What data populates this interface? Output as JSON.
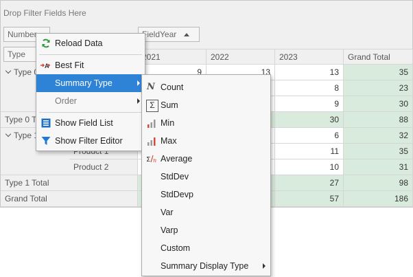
{
  "pivot": {
    "filter_area": "Drop Filter Fields Here",
    "data_field": "Number",
    "column_field": "FieldYear",
    "row_field": "Type",
    "column_headers": [
      "2021",
      "2022",
      "2023",
      "Grand Total"
    ],
    "rows": {
      "type0_header": "Type 0",
      "type0_total": "Type 0 Total",
      "type1_header": "Type 1",
      "type1_prod1": "Product 1",
      "type1_prod2": "Product 2",
      "type1_total": "Type 1 Total",
      "grand_total": "Grand Total"
    },
    "values": {
      "r1": [
        "9",
        "13",
        "13",
        "35"
      ],
      "r2": [
        "8",
        "23"
      ],
      "r3": [
        "9",
        "30"
      ],
      "r4": [
        "30",
        "88"
      ],
      "r5": [
        "6",
        "32"
      ],
      "r6": [
        "11",
        "35"
      ],
      "r7": [
        "10",
        "31"
      ],
      "r8": [
        "27",
        "98"
      ],
      "r9": [
        "57",
        "186"
      ]
    }
  },
  "context_menu": {
    "reload": "Reload Data",
    "best_fit": "Best Fit",
    "summary_type": "Summary Type",
    "order": "Order",
    "field_list": "Show Field List",
    "filter_editor": "Show Filter Editor"
  },
  "submenu": {
    "count": "Count",
    "sum": "Sum",
    "min": "Min",
    "max": "Max",
    "average": "Average",
    "stddev": "StdDev",
    "stddevp": "StdDevp",
    "var": "Var",
    "varp": "Varp",
    "custom": "Custom",
    "display_type": "Summary Display Type"
  },
  "colors": {
    "highlight": "#2e83d6",
    "grand_total_fill": "#d9ebdc",
    "reload_icon": "#2e9a3c",
    "field_list_icon": "#1f6fc7",
    "filter_icon": "#1f7ad6",
    "bar_icon": "#d04a3e"
  }
}
